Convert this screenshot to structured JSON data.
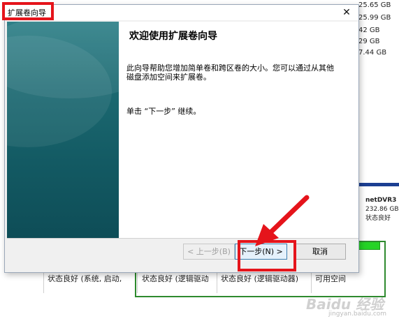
{
  "background": {
    "capacities": [
      "25.65 GB",
      "25.99 GB",
      "42 GB",
      "29 GB",
      "7.44 GB"
    ],
    "disk": {
      "name": "netDVR3",
      "size": "232.86 GB",
      "status": "状态良好"
    },
    "status_cells": [
      "状态良好 (系统, 启动, ",
      "状态良好 (逻辑驱动",
      "状态良好 (逻辑驱动器)",
      "可用空间"
    ],
    "watermark": "Baidu 经验",
    "watermark_sub": "jingyan.baidu.com"
  },
  "dialog": {
    "title": "扩展卷向导",
    "close_glyph": "✕",
    "heading": "欢迎使用扩展卷向导",
    "paragraph": "此向导帮助您增加简单卷和跨区卷的大小。您可以通过从其他磁盘添加空间来扩展卷。",
    "instruction": "单击 “下一步” 继续。",
    "buttons": {
      "back": "< 上一步(B)",
      "next": "下一步(N) >",
      "cancel": "取消"
    }
  },
  "colors": {
    "highlight": "#e5141b",
    "sidebar": "#1c6a72",
    "disk_bar": "#1c3f92",
    "free_space": "#2e8a2e"
  }
}
